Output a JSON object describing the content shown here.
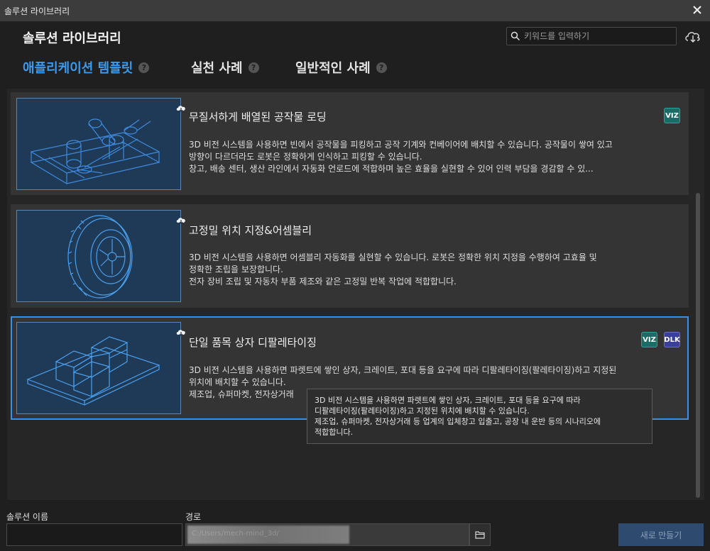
{
  "window": {
    "title": "솔루션 라이브러리"
  },
  "header": {
    "title": "솔루션 라이브러리"
  },
  "search": {
    "placeholder": "키워드를 입력하기"
  },
  "tabs": [
    {
      "label": "애플리케이션 템플릿",
      "active": true,
      "help": "?"
    },
    {
      "label": "실천 사례",
      "active": false,
      "help": "?"
    },
    {
      "label": "일반적인 사례",
      "active": false,
      "help": "?"
    }
  ],
  "cards": [
    {
      "title": "무질서하게 배열된 공작물 로딩",
      "desc": [
        "3D 비전 시스템을 사용하면 빈에서 공작물을 피킹하고 공작 기계와 컨베이어에 배치할 수 있습니다. 공작물이 쌓여 있고",
        "방향이 다르더라도 로봇은 정확하게 인식하고 피킹할 수 있습니다.",
        "창고, 배송 센터, 생산 라인에서 자동화 언로드에 적합하며 높은 효율을 실현할 수 있어 인력 부담을 경감할 수 있..."
      ],
      "badges": [
        "VIZ"
      ],
      "thumbnail": "bin-picking-workpieces"
    },
    {
      "title": "고정밀 위치 지정&어셈블리",
      "desc": [
        "3D 비전 시스템을 사용하면 어셈블리 자동화를 실현할 수 있습니다. 로봇은 정확한 위치 지정을 수행하여 고효율 및",
        "정확한 조립을 보장합니다.",
        "전자 장비 조립 및 자동차 부품 제조와 같은 고정밀 반복 작업에 적합합니다."
      ],
      "badges": [],
      "thumbnail": "tire-wheel"
    },
    {
      "title": "단일 품목 상자 디팔레타이징",
      "desc": [
        "3D 비전 시스템을 사용하면 파렛트에 쌓인 상자, 크레이트, 포대 등을 요구에 따라 디팔레타이징(팔레타이징)하고 지정된",
        "위치에 배치할 수 있습니다.",
        "제조업, 슈퍼마켓, 전자상거래"
      ],
      "badges": [
        "VIZ",
        "DLK"
      ],
      "thumbnail": "boxes-on-pallet",
      "selected": true
    }
  ],
  "tooltip": {
    "lines": [
      "3D 비전 시스템을 사용하면 파렛트에 쌓인 상자, 크레이트, 포대 등을 요구에 따라",
      "디팔레타이징(팔레타이징)하고 지정된 위치에 배치할 수 있습니다.",
      "제조업, 슈퍼마켓, 전자상거래 등 업계의 입체창고 입출고, 공장 내 운반 등의 시나리오에",
      "적합합니다."
    ]
  },
  "footer": {
    "name_label": "솔루션 이름",
    "name_value": "",
    "path_label": "경로",
    "path_value": "C:/Users/mech-mind_3d/",
    "create_label": "새로 만들기"
  },
  "colors": {
    "accent": "#3a9bf0",
    "selected_border": "#3a8ee6",
    "viz_badge": "#1b6b66",
    "dlk_badge": "#3a3f9a"
  }
}
